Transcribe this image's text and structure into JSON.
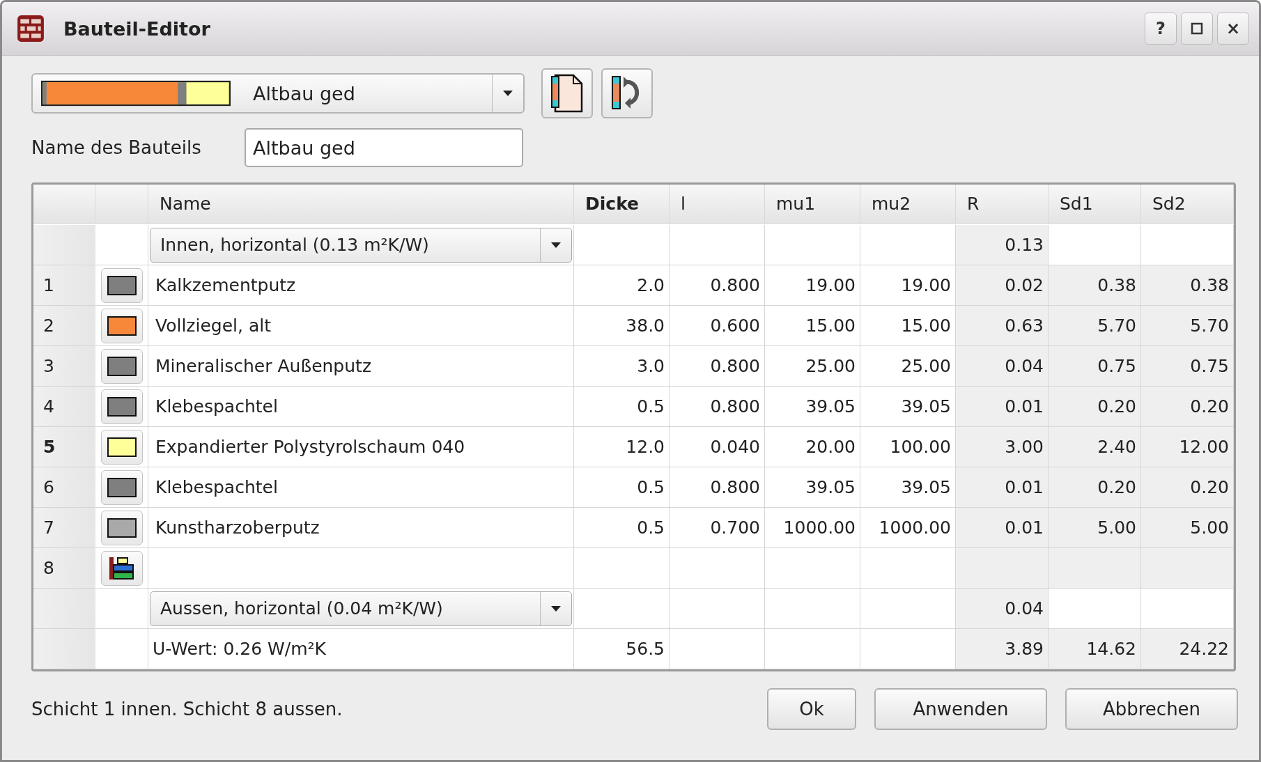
{
  "window": {
    "title": "Bauteil-Editor",
    "help_button": "?",
    "close_button": "×"
  },
  "component_select": {
    "value": "Altbau ged"
  },
  "name_field": {
    "label": "Name des Bauteils",
    "value": "Altbau ged"
  },
  "table": {
    "columns": [
      {
        "label": "Name",
        "highlighted": false
      },
      {
        "label": "Dicke",
        "highlighted": true
      },
      {
        "label": "l",
        "highlighted": false
      },
      {
        "label": "mu1",
        "highlighted": false
      },
      {
        "label": "mu2",
        "highlighted": false
      },
      {
        "label": "R",
        "highlighted": false
      },
      {
        "label": "Sd1",
        "highlighted": false
      },
      {
        "label": "Sd2",
        "highlighted": false
      }
    ],
    "rows": [
      {
        "kind": "boundary",
        "option": "Innen, horizontal (0.13 m²K/W)",
        "r": "0.13"
      },
      {
        "kind": "layer",
        "number": "1",
        "selected": false,
        "color": "#7f7f7f",
        "name": "Kalkzementputz",
        "values": [
          "2.0",
          "0.800",
          "19.00",
          "19.00",
          "0.02",
          "0.38",
          "0.38"
        ]
      },
      {
        "kind": "layer",
        "number": "2",
        "selected": false,
        "color": "#f7883a",
        "name": "Vollziegel, alt",
        "values": [
          "38.0",
          "0.600",
          "15.00",
          "15.00",
          "0.63",
          "5.70",
          "5.70"
        ]
      },
      {
        "kind": "layer",
        "number": "3",
        "selected": false,
        "color": "#7f7f7f",
        "name": "Mineralischer Außenputz",
        "values": [
          "3.0",
          "0.800",
          "25.00",
          "25.00",
          "0.04",
          "0.75",
          "0.75"
        ]
      },
      {
        "kind": "layer",
        "number": "4",
        "selected": false,
        "color": "#7f7f7f",
        "name": "Klebespachtel",
        "values": [
          "0.5",
          "0.800",
          "39.05",
          "39.05",
          "0.01",
          "0.20",
          "0.20"
        ]
      },
      {
        "kind": "layer",
        "number": "5",
        "selected": true,
        "color": "#ffff99",
        "name": "Expandierter Polystyrolschaum 040",
        "values": [
          "12.0",
          "0.040",
          "20.00",
          "100.00",
          "3.00",
          "2.40",
          "12.00"
        ]
      },
      {
        "kind": "layer",
        "number": "6",
        "selected": false,
        "color": "#7f7f7f",
        "name": "Klebespachtel",
        "values": [
          "0.5",
          "0.800",
          "39.05",
          "39.05",
          "0.01",
          "0.20",
          "0.20"
        ]
      },
      {
        "kind": "layer",
        "number": "7",
        "selected": false,
        "color": "#a9a9a9",
        "name": "Kunstharzoberputz",
        "values": [
          "0.5",
          "0.700",
          "1000.00",
          "1000.00",
          "0.01",
          "5.00",
          "5.00"
        ]
      },
      {
        "kind": "add",
        "number": "8"
      },
      {
        "kind": "boundary",
        "option": "Aussen, horizontal (0.04 m²K/W)",
        "r": "0.04"
      },
      {
        "kind": "total",
        "label": "U-Wert: 0.26 W/m²K",
        "dicke": "56.5",
        "r": "3.89",
        "sd1": "14.62",
        "sd2": "24.22"
      }
    ]
  },
  "status": "Schicht 1 innen. Schicht 8 aussen.",
  "buttons": [
    "Ok",
    "Anwenden",
    "Abbrechen"
  ]
}
